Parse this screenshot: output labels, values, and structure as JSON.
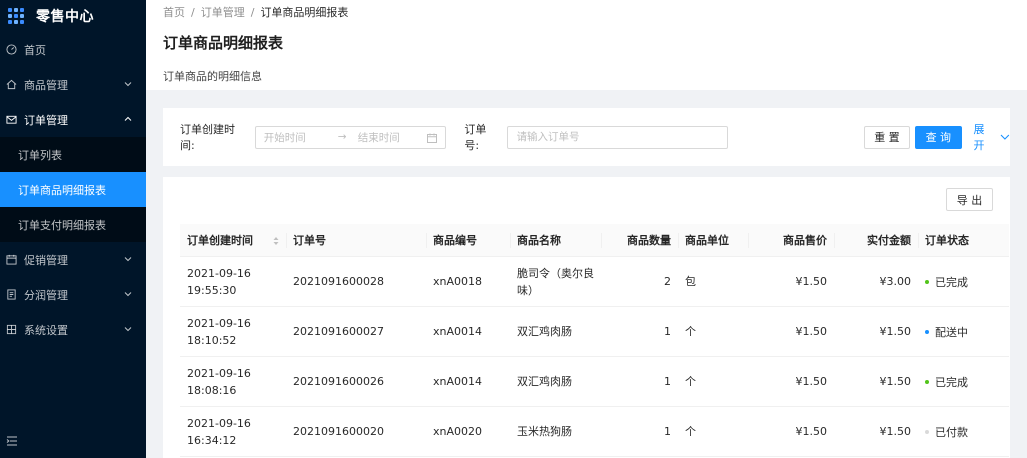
{
  "app": {
    "title": "零售中心"
  },
  "sidebar": {
    "items": [
      {
        "label": "首页",
        "icon": "dashboard-icon"
      },
      {
        "label": "商品管理",
        "icon": "home-icon"
      },
      {
        "label": "订单管理",
        "icon": "mail-icon",
        "open": true
      },
      {
        "label": "促销管理",
        "icon": "calendar-icon"
      },
      {
        "label": "分润管理",
        "icon": "file-icon"
      },
      {
        "label": "系统设置",
        "icon": "setting-icon"
      }
    ],
    "order_submenu": [
      {
        "label": "订单列表"
      },
      {
        "label": "订单商品明细报表",
        "active": true
      },
      {
        "label": "订单支付明细报表"
      }
    ]
  },
  "breadcrumb": {
    "home": "首页",
    "parent": "订单管理",
    "current": "订单商品明细报表",
    "separator": "/"
  },
  "page": {
    "title": "订单商品明细报表",
    "description": "订单商品的明细信息"
  },
  "search": {
    "created_label": "订单创建时间:",
    "start_placeholder": "开始时间",
    "arrow": "→",
    "end_placeholder": "结束时间",
    "order_label": "订单号:",
    "order_placeholder": "请输入订单号",
    "reset_label": "重 置",
    "query_label": "查 询",
    "expand_label": "展开"
  },
  "table": {
    "export_label": "导 出",
    "columns": [
      "订单创建时间",
      "订单号",
      "商品编号",
      "商品名称",
      "商品数量",
      "商品单位",
      "商品售价",
      "实付金额",
      "订单状态"
    ],
    "rows": [
      {
        "date": "2021-09-16",
        "time": "19:55:30",
        "order_no": "2021091600028",
        "sku": "xnA0018",
        "name": "脆司令（奥尔良味）",
        "qty": "2",
        "unit": "包",
        "price": "¥1.50",
        "paid": "¥3.00",
        "status": "已完成",
        "status_color": "#52c41a"
      },
      {
        "date": "2021-09-16",
        "time": "18:10:52",
        "order_no": "2021091600027",
        "sku": "xnA0014",
        "name": "双汇鸡肉肠",
        "qty": "1",
        "unit": "个",
        "price": "¥1.50",
        "paid": "¥1.50",
        "status": "配送中",
        "status_color": "#1890ff"
      },
      {
        "date": "2021-09-16",
        "time": "18:08:16",
        "order_no": "2021091600026",
        "sku": "xnA0014",
        "name": "双汇鸡肉肠",
        "qty": "1",
        "unit": "个",
        "price": "¥1.50",
        "paid": "¥1.50",
        "status": "已完成",
        "status_color": "#52c41a"
      },
      {
        "date": "2021-09-16",
        "time": "16:34:12",
        "order_no": "2021091600020",
        "sku": "xnA0020",
        "name": "玉米热狗肠",
        "qty": "1",
        "unit": "个",
        "price": "¥1.50",
        "paid": "¥1.50",
        "status": "已付款",
        "status_color": "#d9d9d9"
      }
    ]
  },
  "colors": {
    "sider_bg": "#001529",
    "submenu_bg": "#000c17",
    "primary": "#1890ff"
  }
}
